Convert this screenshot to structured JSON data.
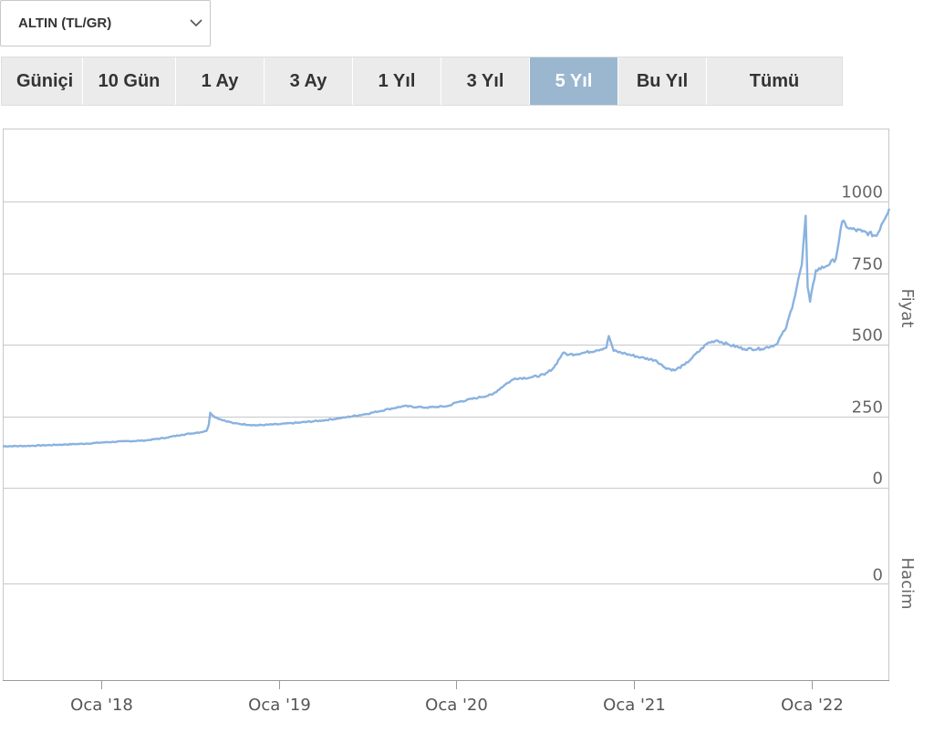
{
  "instrument_select": {
    "selected": "ALTIN (TL/GR)"
  },
  "range_tabs": [
    {
      "label": "Güniçi",
      "active": false
    },
    {
      "label": "10 Gün",
      "active": false
    },
    {
      "label": "1 Ay",
      "active": false
    },
    {
      "label": "3 Ay",
      "active": false
    },
    {
      "label": "1 Yıl",
      "active": false
    },
    {
      "label": "3 Yıl",
      "active": false
    },
    {
      "label": "5 Yıl",
      "active": true
    },
    {
      "label": "Bu Yıl",
      "active": false
    },
    {
      "label": "Tümü",
      "active": false
    }
  ],
  "colors": {
    "line": "#8ab2e0",
    "grid": "#c8c8c8",
    "active_tab": "#9ab7cf"
  },
  "chart_data": {
    "type": "line",
    "price_axis": {
      "label": "Fiyat",
      "ticks": [
        0,
        250,
        500,
        750,
        1000
      ],
      "ylim": [
        0,
        1000
      ]
    },
    "volume_axis": {
      "label": "Hacim",
      "ticks": [
        0
      ]
    },
    "x_ticks": [
      {
        "label": "Oca '18",
        "date": "2018-01-01"
      },
      {
        "label": "Oca '19",
        "date": "2019-01-01"
      },
      {
        "label": "Oca '20",
        "date": "2020-01-01"
      },
      {
        "label": "Oca '21",
        "date": "2021-01-01"
      },
      {
        "label": "Oca '22",
        "date": "2022-01-01"
      }
    ],
    "xlim": [
      "2017-06-12",
      "2022-06-10"
    ],
    "series": [
      {
        "points": [
          [
            "2017-06-12",
            145
          ],
          [
            "2017-08-01",
            146
          ],
          [
            "2017-10-01",
            150
          ],
          [
            "2017-12-01",
            154
          ],
          [
            "2018-01-01",
            158
          ],
          [
            "2018-02-15",
            162
          ],
          [
            "2018-04-01",
            165
          ],
          [
            "2018-05-15",
            175
          ],
          [
            "2018-06-15",
            185
          ],
          [
            "2018-07-15",
            192
          ],
          [
            "2018-08-05",
            198
          ],
          [
            "2018-08-10",
            220
          ],
          [
            "2018-08-13",
            262
          ],
          [
            "2018-08-20",
            250
          ],
          [
            "2018-09-01",
            240
          ],
          [
            "2018-10-01",
            225
          ],
          [
            "2018-11-15",
            218
          ],
          [
            "2019-01-01",
            222
          ],
          [
            "2019-02-15",
            228
          ],
          [
            "2019-04-01",
            235
          ],
          [
            "2019-05-15",
            245
          ],
          [
            "2019-07-01",
            258
          ],
          [
            "2019-08-15",
            275
          ],
          [
            "2019-09-15",
            285
          ],
          [
            "2019-11-01",
            280
          ],
          [
            "2019-12-15",
            285
          ],
          [
            "2020-01-01",
            298
          ],
          [
            "2020-02-15",
            315
          ],
          [
            "2020-03-15",
            325
          ],
          [
            "2020-04-10",
            360
          ],
          [
            "2020-05-01",
            382
          ],
          [
            "2020-06-01",
            385
          ],
          [
            "2020-07-01",
            395
          ],
          [
            "2020-07-20",
            420
          ],
          [
            "2020-08-07",
            470
          ],
          [
            "2020-08-20",
            465
          ],
          [
            "2020-09-15",
            470
          ],
          [
            "2020-10-15",
            480
          ],
          [
            "2020-11-05",
            490
          ],
          [
            "2020-11-10",
            530
          ],
          [
            "2020-11-20",
            478
          ],
          [
            "2020-12-15",
            468
          ],
          [
            "2021-01-15",
            455
          ],
          [
            "2021-02-15",
            445
          ],
          [
            "2021-03-05",
            420
          ],
          [
            "2021-03-25",
            410
          ],
          [
            "2021-04-15",
            430
          ],
          [
            "2021-05-01",
            455
          ],
          [
            "2021-06-01",
            505
          ],
          [
            "2021-06-20",
            515
          ],
          [
            "2021-07-15",
            500
          ],
          [
            "2021-08-15",
            485
          ],
          [
            "2021-09-20",
            485
          ],
          [
            "2021-10-20",
            500
          ],
          [
            "2021-11-10",
            560
          ],
          [
            "2021-11-25",
            650
          ],
          [
            "2021-12-05",
            730
          ],
          [
            "2021-12-12",
            780
          ],
          [
            "2021-12-20",
            950
          ],
          [
            "2021-12-24",
            700
          ],
          [
            "2021-12-29",
            650
          ],
          [
            "2022-01-10",
            760
          ],
          [
            "2022-02-01",
            775
          ],
          [
            "2022-02-20",
            800
          ],
          [
            "2022-03-05",
            930
          ],
          [
            "2022-03-20",
            905
          ],
          [
            "2022-04-15",
            895
          ],
          [
            "2022-05-15",
            880
          ],
          [
            "2022-05-25",
            920
          ],
          [
            "2022-06-10",
            975
          ]
        ]
      }
    ]
  }
}
